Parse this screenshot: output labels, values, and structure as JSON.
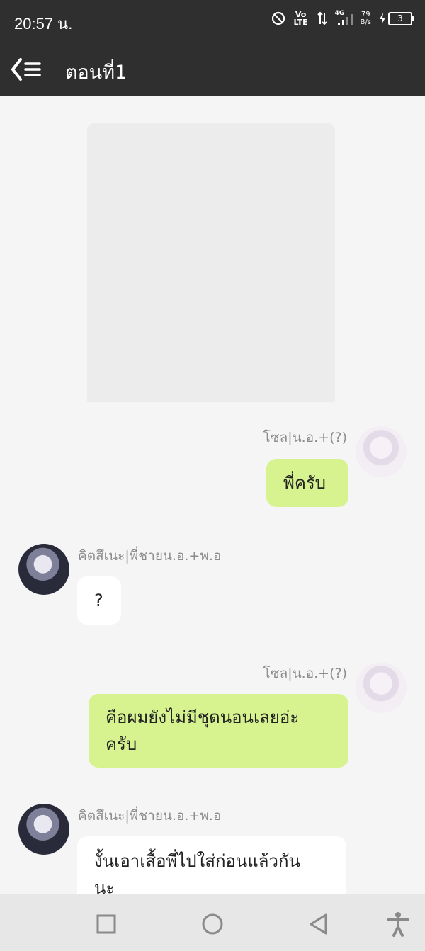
{
  "status_bar": {
    "time": "20:57 น.",
    "volte": "Vo LTE",
    "net_type": "4G",
    "speed_value": "79",
    "speed_unit": "B/s",
    "battery": "3"
  },
  "header": {
    "title": "ตอนที่1",
    "back_icon": "back-list-icon"
  },
  "messages": [
    {
      "side": "right",
      "sender": "โซล|น.อ.+(?)",
      "lines": [
        "พี่ครับ"
      ]
    },
    {
      "side": "left",
      "sender": "คิตสึเนะ|พี่ชายน.อ.+พ.อ",
      "lines": [
        "?"
      ]
    },
    {
      "side": "right",
      "sender": "โซล|น.อ.+(?)",
      "lines": [
        "คือผมยังไม่มีชุดนอนเลยอ่ะ",
        "ครับ"
      ]
    },
    {
      "side": "left",
      "sender": "คิตสึเนะ|พี่ชายน.อ.+พ.อ",
      "lines": [
        "งั้นเอาเสื้อพี่ไปใส่ก่อนแล้วกัน",
        "นะ"
      ]
    }
  ],
  "colors": {
    "header_bg": "#2f2f2f",
    "chat_bg": "#f5f5f5",
    "bubble_self": "#d6f38f",
    "bubble_other": "#ffffff",
    "navbar_bg": "#e7e7e7"
  },
  "navbar": {
    "icons": [
      "recent-apps-icon",
      "home-icon",
      "back-icon",
      "accessibility-icon"
    ]
  }
}
